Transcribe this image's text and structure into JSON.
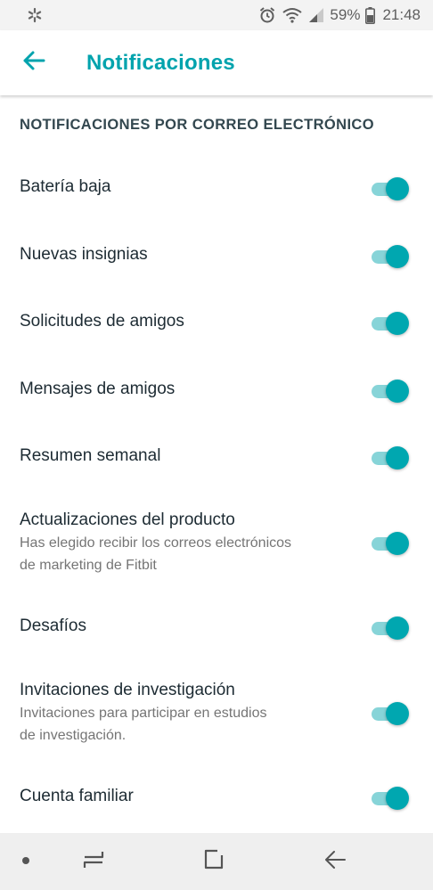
{
  "status_bar": {
    "left_icon": "asterisk-icon",
    "icons": [
      "alarm-icon",
      "wifi-icon",
      "signal-icon"
    ],
    "battery_percent": "59%",
    "battery_icon": "battery-icon",
    "time": "21:48"
  },
  "app_bar": {
    "back_icon": "arrow-left-icon",
    "title": "Notificaciones"
  },
  "section": {
    "header": "NOTIFICACIONES POR CORREO ELECTRÓNICO"
  },
  "settings": [
    {
      "label": "Batería baja",
      "enabled": true
    },
    {
      "label": "Nuevas insignias",
      "enabled": true
    },
    {
      "label": "Solicitudes de amigos",
      "enabled": true
    },
    {
      "label": "Mensajes de amigos",
      "enabled": true
    },
    {
      "label": "Resumen semanal",
      "enabled": true
    },
    {
      "label": "Actualizaciones del producto",
      "sub1": "Has elegido recibir los correos electrónicos",
      "sub2": "de marketing de Fitbit",
      "enabled": true
    },
    {
      "label": "Desafíos",
      "enabled": true
    },
    {
      "label": "Invitaciones de investigación",
      "sub1": "Invitaciones para participar en estudios",
      "sub2": "de investigación.",
      "enabled": true
    },
    {
      "label": "Cuenta familiar",
      "enabled": true
    }
  ],
  "nav_bar": {
    "items": [
      "dot-icon",
      "recents-icon",
      "home-icon",
      "back-icon"
    ]
  },
  "colors": {
    "accent": "#00a3ad",
    "toggle_thumb": "#00a7b0",
    "toggle_track": "#87d4d8",
    "text_primary": "#1d2b33",
    "text_secondary": "#757575"
  }
}
